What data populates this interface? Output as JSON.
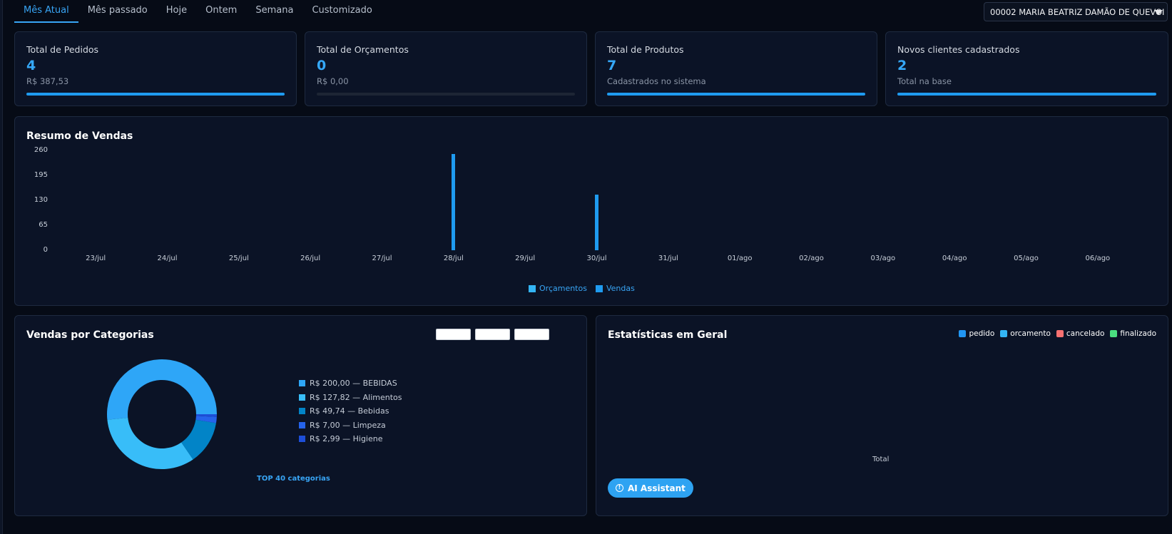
{
  "tabs": [
    {
      "label": "Mês Atual",
      "active": true
    },
    {
      "label": "Mês passado"
    },
    {
      "label": "Hoje"
    },
    {
      "label": "Ontem"
    },
    {
      "label": "Semana"
    },
    {
      "label": "Customizado"
    }
  ],
  "client_select": {
    "value": "00002 MARIA BEATRIZ DAMÃO DE QUEVOI"
  },
  "cards": [
    {
      "title": "Total de Pedidos",
      "value": "4",
      "sub": "R$ 387,53",
      "progress": 1.0
    },
    {
      "title": "Total de Orçamentos",
      "value": "0",
      "sub": "R$ 0,00",
      "progress": 0.0
    },
    {
      "title": "Total de Produtos",
      "value": "7",
      "sub": "Cadastrados no sistema",
      "progress": 1.0
    },
    {
      "title": "Novos clientes cadastrados",
      "value": "2",
      "sub": "Total na base",
      "progress": 1.0
    }
  ],
  "sales_summary": {
    "title": "Resumo de Vendas",
    "legend": {
      "orcamentos": "Orçamentos",
      "vendas": "Vendas"
    }
  },
  "colors": {
    "accent": "#38a5f5",
    "orcamentos": "#33b5f5",
    "vendas": "#1f9bf0",
    "pedido": "#2196f3",
    "orcamento": "#33b5f5",
    "cancelado": "#f87171",
    "finalizado": "#4ade80"
  },
  "chart_data": [
    {
      "type": "bar",
      "categories": [
        "23/jul",
        "24/jul",
        "25/jul",
        "26/jul",
        "27/jul",
        "28/jul",
        "29/jul",
        "30/jul",
        "31/jul",
        "01/ago",
        "02/ago",
        "03/ago",
        "04/ago",
        "05/ago",
        "06/ago"
      ],
      "series": [
        {
          "name": "Orçamentos",
          "values": [
            0,
            0,
            0,
            0,
            0,
            0,
            0,
            0,
            0,
            0,
            0,
            0,
            0,
            0,
            0
          ]
        },
        {
          "name": "Vendas",
          "values": [
            0,
            0,
            0,
            0,
            0,
            250,
            0,
            145,
            0,
            0,
            0,
            0,
            0,
            0,
            0
          ]
        }
      ],
      "yticks": [
        "260",
        "195",
        "130",
        "65",
        "0"
      ],
      "ylim": [
        0,
        260
      ],
      "grid": false,
      "legend": "bottom-center"
    },
    {
      "type": "pie",
      "donut": true,
      "labels": [
        "BEBIDAS",
        "Alimentos",
        "Bebidas",
        "Limpeza",
        "Higiene"
      ],
      "values": [
        200.0,
        127.82,
        49.74,
        7.0,
        2.99
      ],
      "display": [
        "R$ 200,00 — BEBIDAS",
        "R$ 127,82 — Alimentos",
        "R$ 49,74 — Bebidas",
        "R$ 7,00 — Limpeza",
        "R$ 2,99 — Higiene"
      ],
      "colors": [
        "#2ea6f7",
        "#38bdf8",
        "#0284c7",
        "#2563eb",
        "#1d4ed8"
      ],
      "legend": "right"
    }
  ],
  "categories_panel": {
    "title": "Vendas por Categorias",
    "top_link": "TOP 40 categorias"
  },
  "stats_panel": {
    "title": "Estatísticas em Geral",
    "legend": [
      "pedido",
      "orcamento",
      "cancelado",
      "finalizado"
    ],
    "x_label": "Total",
    "ai_button": "AI Assistant"
  }
}
